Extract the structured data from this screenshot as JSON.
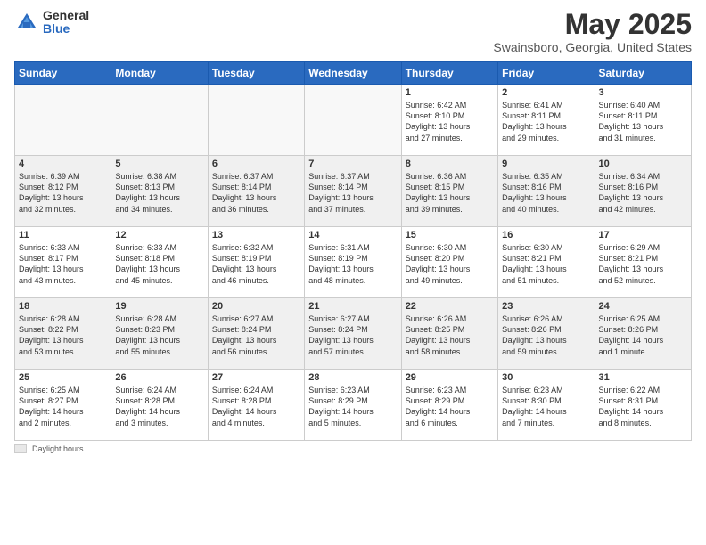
{
  "header": {
    "logo_general": "General",
    "logo_blue": "Blue",
    "main_title": "May 2025",
    "subtitle": "Swainsboro, Georgia, United States"
  },
  "calendar": {
    "days_of_week": [
      "Sunday",
      "Monday",
      "Tuesday",
      "Wednesday",
      "Thursday",
      "Friday",
      "Saturday"
    ],
    "weeks": [
      [
        {
          "day": "",
          "info": ""
        },
        {
          "day": "",
          "info": ""
        },
        {
          "day": "",
          "info": ""
        },
        {
          "day": "",
          "info": ""
        },
        {
          "day": "1",
          "info": "Sunrise: 6:42 AM\nSunset: 8:10 PM\nDaylight: 13 hours\nand 27 minutes."
        },
        {
          "day": "2",
          "info": "Sunrise: 6:41 AM\nSunset: 8:11 PM\nDaylight: 13 hours\nand 29 minutes."
        },
        {
          "day": "3",
          "info": "Sunrise: 6:40 AM\nSunset: 8:11 PM\nDaylight: 13 hours\nand 31 minutes."
        }
      ],
      [
        {
          "day": "4",
          "info": "Sunrise: 6:39 AM\nSunset: 8:12 PM\nDaylight: 13 hours\nand 32 minutes."
        },
        {
          "day": "5",
          "info": "Sunrise: 6:38 AM\nSunset: 8:13 PM\nDaylight: 13 hours\nand 34 minutes."
        },
        {
          "day": "6",
          "info": "Sunrise: 6:37 AM\nSunset: 8:14 PM\nDaylight: 13 hours\nand 36 minutes."
        },
        {
          "day": "7",
          "info": "Sunrise: 6:37 AM\nSunset: 8:14 PM\nDaylight: 13 hours\nand 37 minutes."
        },
        {
          "day": "8",
          "info": "Sunrise: 6:36 AM\nSunset: 8:15 PM\nDaylight: 13 hours\nand 39 minutes."
        },
        {
          "day": "9",
          "info": "Sunrise: 6:35 AM\nSunset: 8:16 PM\nDaylight: 13 hours\nand 40 minutes."
        },
        {
          "day": "10",
          "info": "Sunrise: 6:34 AM\nSunset: 8:16 PM\nDaylight: 13 hours\nand 42 minutes."
        }
      ],
      [
        {
          "day": "11",
          "info": "Sunrise: 6:33 AM\nSunset: 8:17 PM\nDaylight: 13 hours\nand 43 minutes."
        },
        {
          "day": "12",
          "info": "Sunrise: 6:33 AM\nSunset: 8:18 PM\nDaylight: 13 hours\nand 45 minutes."
        },
        {
          "day": "13",
          "info": "Sunrise: 6:32 AM\nSunset: 8:19 PM\nDaylight: 13 hours\nand 46 minutes."
        },
        {
          "day": "14",
          "info": "Sunrise: 6:31 AM\nSunset: 8:19 PM\nDaylight: 13 hours\nand 48 minutes."
        },
        {
          "day": "15",
          "info": "Sunrise: 6:30 AM\nSunset: 8:20 PM\nDaylight: 13 hours\nand 49 minutes."
        },
        {
          "day": "16",
          "info": "Sunrise: 6:30 AM\nSunset: 8:21 PM\nDaylight: 13 hours\nand 51 minutes."
        },
        {
          "day": "17",
          "info": "Sunrise: 6:29 AM\nSunset: 8:21 PM\nDaylight: 13 hours\nand 52 minutes."
        }
      ],
      [
        {
          "day": "18",
          "info": "Sunrise: 6:28 AM\nSunset: 8:22 PM\nDaylight: 13 hours\nand 53 minutes."
        },
        {
          "day": "19",
          "info": "Sunrise: 6:28 AM\nSunset: 8:23 PM\nDaylight: 13 hours\nand 55 minutes."
        },
        {
          "day": "20",
          "info": "Sunrise: 6:27 AM\nSunset: 8:24 PM\nDaylight: 13 hours\nand 56 minutes."
        },
        {
          "day": "21",
          "info": "Sunrise: 6:27 AM\nSunset: 8:24 PM\nDaylight: 13 hours\nand 57 minutes."
        },
        {
          "day": "22",
          "info": "Sunrise: 6:26 AM\nSunset: 8:25 PM\nDaylight: 13 hours\nand 58 minutes."
        },
        {
          "day": "23",
          "info": "Sunrise: 6:26 AM\nSunset: 8:26 PM\nDaylight: 13 hours\nand 59 minutes."
        },
        {
          "day": "24",
          "info": "Sunrise: 6:25 AM\nSunset: 8:26 PM\nDaylight: 14 hours\nand 1 minute."
        }
      ],
      [
        {
          "day": "25",
          "info": "Sunrise: 6:25 AM\nSunset: 8:27 PM\nDaylight: 14 hours\nand 2 minutes."
        },
        {
          "day": "26",
          "info": "Sunrise: 6:24 AM\nSunset: 8:28 PM\nDaylight: 14 hours\nand 3 minutes."
        },
        {
          "day": "27",
          "info": "Sunrise: 6:24 AM\nSunset: 8:28 PM\nDaylight: 14 hours\nand 4 minutes."
        },
        {
          "day": "28",
          "info": "Sunrise: 6:23 AM\nSunset: 8:29 PM\nDaylight: 14 hours\nand 5 minutes."
        },
        {
          "day": "29",
          "info": "Sunrise: 6:23 AM\nSunset: 8:29 PM\nDaylight: 14 hours\nand 6 minutes."
        },
        {
          "day": "30",
          "info": "Sunrise: 6:23 AM\nSunset: 8:30 PM\nDaylight: 14 hours\nand 7 minutes."
        },
        {
          "day": "31",
          "info": "Sunrise: 6:22 AM\nSunset: 8:31 PM\nDaylight: 14 hours\nand 8 minutes."
        }
      ]
    ]
  },
  "footer": {
    "daylight_label": "Daylight hours"
  }
}
